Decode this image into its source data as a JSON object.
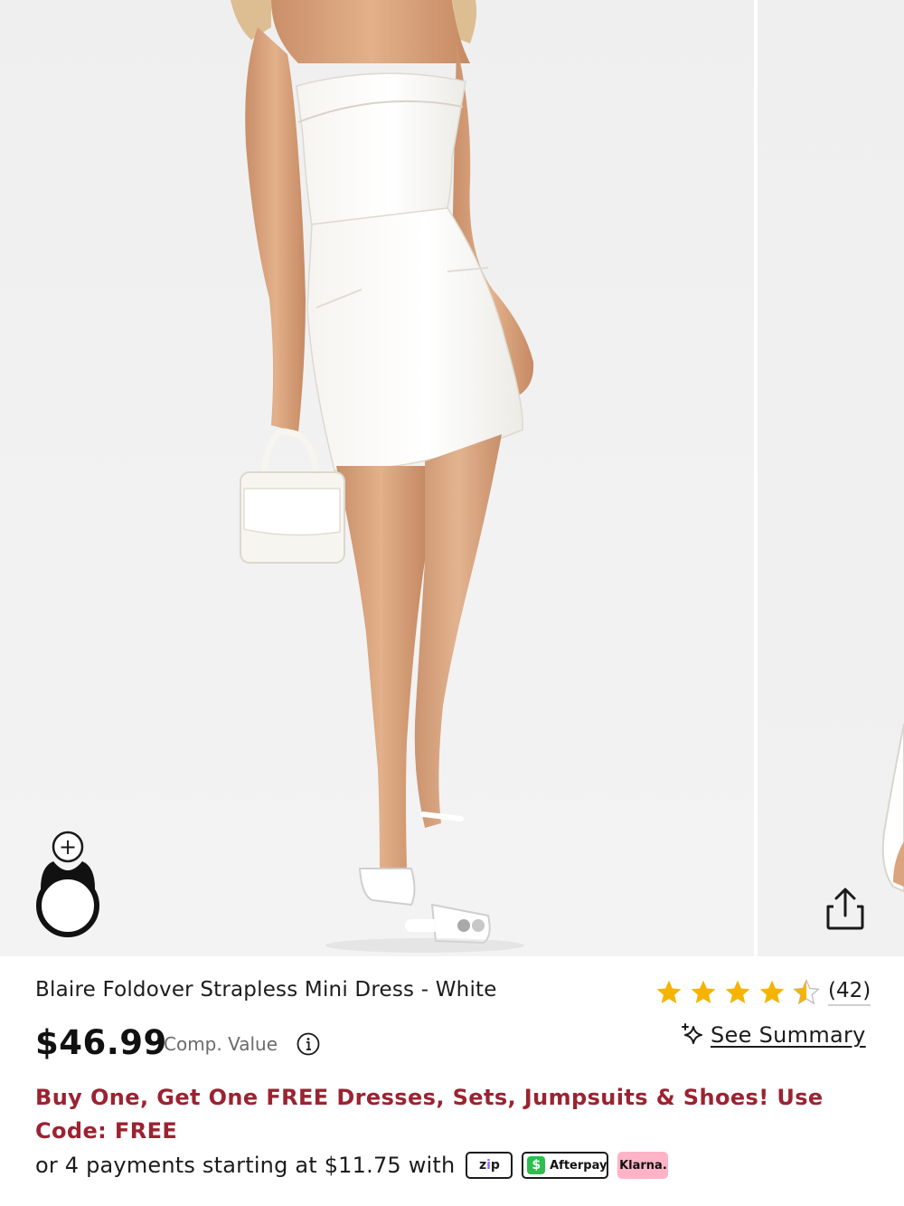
{
  "product": {
    "title": "Blaire Foldover Strapless Mini Dress - White",
    "price": "$46.99",
    "comp_value_label": "Comp. Value",
    "rating_value": 4.5,
    "rating_max": 5,
    "review_count": "(42)",
    "see_summary_label": "See Summary",
    "promo_text": "Buy One, Get One FREE Dresses, Sets, Jumpsuits & Shoes! Use Code: FREE",
    "payments_text": "or 4 payments starting at $11.75 with",
    "payment_providers": {
      "zip": "zip",
      "afterpay": "Afterpay",
      "klarna": "Klarna."
    }
  },
  "gallery": {
    "active_index": 0,
    "dot_count": 3,
    "try_on_symbol": "+",
    "share_icon": "share-icon"
  },
  "colors": {
    "promo": "#9b2331",
    "star": "#f5b400",
    "afterpay": "#2bbf4d",
    "klarna": "#ffb3c7",
    "zip_accent": "#8e6cf0"
  }
}
